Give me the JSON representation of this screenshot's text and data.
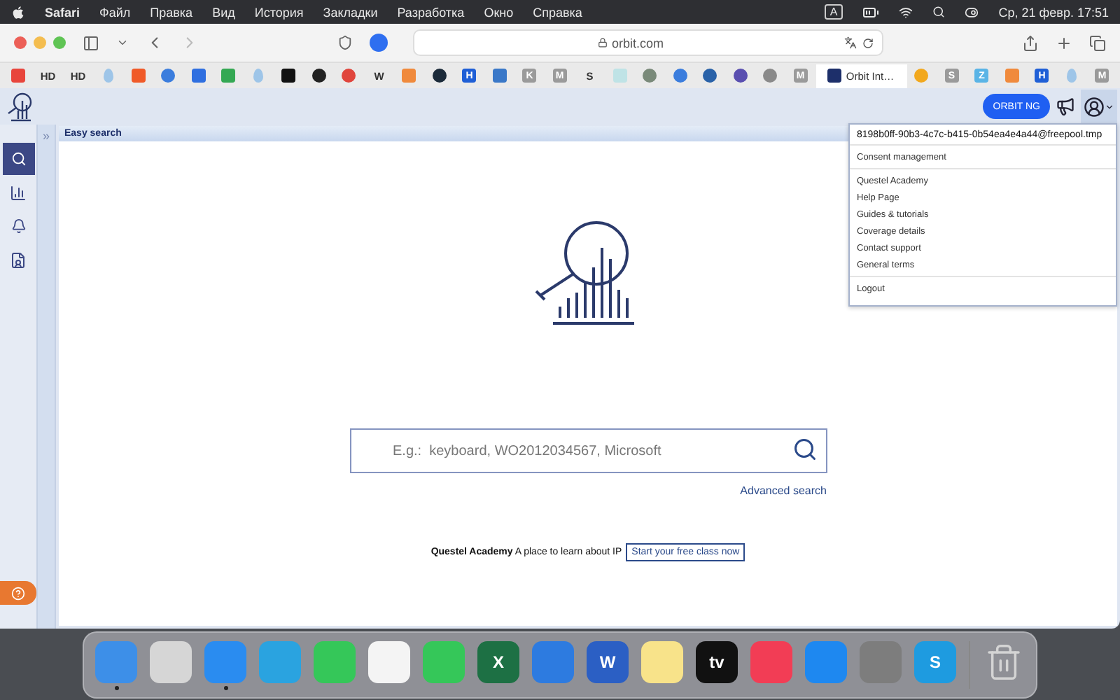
{
  "menu_bar": {
    "app": "Safari",
    "items": [
      "Файл",
      "Правка",
      "Вид",
      "История",
      "Закладки",
      "Разработка",
      "Окно",
      "Справка"
    ],
    "input_source": "A",
    "clock": "Ср, 21 февр. 17:51"
  },
  "browser": {
    "address": "orbit.com"
  },
  "bookmarks": [
    {
      "kind": "tile",
      "color": "#e8453c"
    },
    {
      "kind": "text",
      "label": "HD"
    },
    {
      "kind": "text",
      "label": "HD"
    },
    {
      "kind": "drop",
      "color": "#9ec5e8"
    },
    {
      "kind": "tile",
      "color": "#f05a28"
    },
    {
      "kind": "dot",
      "color": "#3b7ddd"
    },
    {
      "kind": "tile",
      "color": "#2f6fe0"
    },
    {
      "kind": "tile",
      "color": "#34a853"
    },
    {
      "kind": "drop",
      "color": "#9ec5e8"
    },
    {
      "kind": "tile",
      "color": "#111111"
    },
    {
      "kind": "dot",
      "color": "#222222"
    },
    {
      "kind": "dot",
      "color": "#e0453c"
    },
    {
      "kind": "text",
      "label": "W"
    },
    {
      "kind": "tile",
      "color": "#f08a3c"
    },
    {
      "kind": "dot",
      "color": "#1c2b3a"
    },
    {
      "kind": "tile",
      "color": "#1f5fd6",
      "label": "H"
    },
    {
      "kind": "tile",
      "color": "#3a78c8"
    },
    {
      "kind": "tile",
      "color": "#9a9a9a",
      "label": "K"
    },
    {
      "kind": "tile",
      "color": "#9a9a9a",
      "label": "M"
    },
    {
      "kind": "text",
      "label": "S"
    },
    {
      "kind": "tile",
      "color": "#bfe3e6"
    },
    {
      "kind": "dot",
      "color": "#7a8a7a"
    },
    {
      "kind": "dot",
      "color": "#3b7ddd"
    },
    {
      "kind": "dot",
      "color": "#2a62a8"
    },
    {
      "kind": "dot",
      "color": "#5a4fb0"
    },
    {
      "kind": "dot",
      "color": "#8a8a8a"
    },
    {
      "kind": "tile",
      "color": "#9a9a9a",
      "label": "M"
    },
    {
      "kind": "tab",
      "label": "Orbit Int…"
    },
    {
      "kind": "dot",
      "color": "#f2a81d"
    },
    {
      "kind": "tile",
      "color": "#9a9a9a",
      "label": "S"
    },
    {
      "kind": "tile",
      "color": "#5ab4e6",
      "label": "Z"
    },
    {
      "kind": "tile",
      "color": "#f08a3c"
    },
    {
      "kind": "tile",
      "color": "#1f5fd6",
      "label": "H"
    },
    {
      "kind": "drop",
      "color": "#9ec5e8"
    },
    {
      "kind": "tile",
      "color": "#9a9a9a",
      "label": "M"
    }
  ],
  "header": {
    "product_button": "ORBIT NG"
  },
  "rail": [
    {
      "kind": "search",
      "selected": true
    },
    {
      "kind": "analytics",
      "selected": false
    },
    {
      "kind": "alerts",
      "selected": false
    },
    {
      "kind": "documents",
      "selected": false
    }
  ],
  "panel": {
    "collapse": "»",
    "title": "Easy search",
    "search": {
      "placeholder": "E.g.:  keyboard, WO2012034567, Microsoft"
    },
    "advanced_link": "Advanced search",
    "academy_text": "**Questel Academy** A place to learn about IP",
    "academy_button": "Start your free class now"
  },
  "user_menu": {
    "account": "8198b0ff-90b3-4c7c-b415-0b54ea4e4a44@freepool.tmp",
    "groups": [
      [
        "Consent management"
      ],
      [
        "Questel Academy",
        "Help Page",
        "Guides & tutorials",
        "Coverage details",
        "Contact support",
        "General terms"
      ],
      [
        "Logout"
      ]
    ]
  },
  "dock": [
    {
      "kind": "app",
      "color": "#3d8fe8",
      "running": true
    },
    {
      "kind": "app",
      "color": "#d6d6d6",
      "running": false
    },
    {
      "kind": "app",
      "color": "#2a8cf0",
      "running": true
    },
    {
      "kind": "app",
      "color": "#2aa3e0",
      "running": false
    },
    {
      "kind": "app",
      "color": "#35c759",
      "running": false
    },
    {
      "kind": "app",
      "color": "#f4f4f4",
      "running": false
    },
    {
      "kind": "app",
      "color": "#35c759",
      "running": false
    },
    {
      "kind": "app",
      "color": "#1d7044",
      "glyph": "X",
      "running": false
    },
    {
      "kind": "app",
      "color": "#2d7be0",
      "running": false
    },
    {
      "kind": "app",
      "color": "#2b5fc4",
      "glyph": "W",
      "running": false
    },
    {
      "kind": "app",
      "color": "#f8e38a",
      "running": false
    },
    {
      "kind": "app",
      "color": "#111111",
      "glyph": "tv",
      "running": false
    },
    {
      "kind": "app",
      "color": "#f23d55",
      "running": false
    },
    {
      "kind": "app",
      "color": "#1e88f0",
      "running": false
    },
    {
      "kind": "app",
      "color": "#7d7d7d",
      "running": false
    },
    {
      "kind": "app",
      "color": "#1e9be0",
      "glyph": "S",
      "running": false
    },
    {
      "kind": "trash",
      "color": "#d4d4d4",
      "running": false
    }
  ]
}
